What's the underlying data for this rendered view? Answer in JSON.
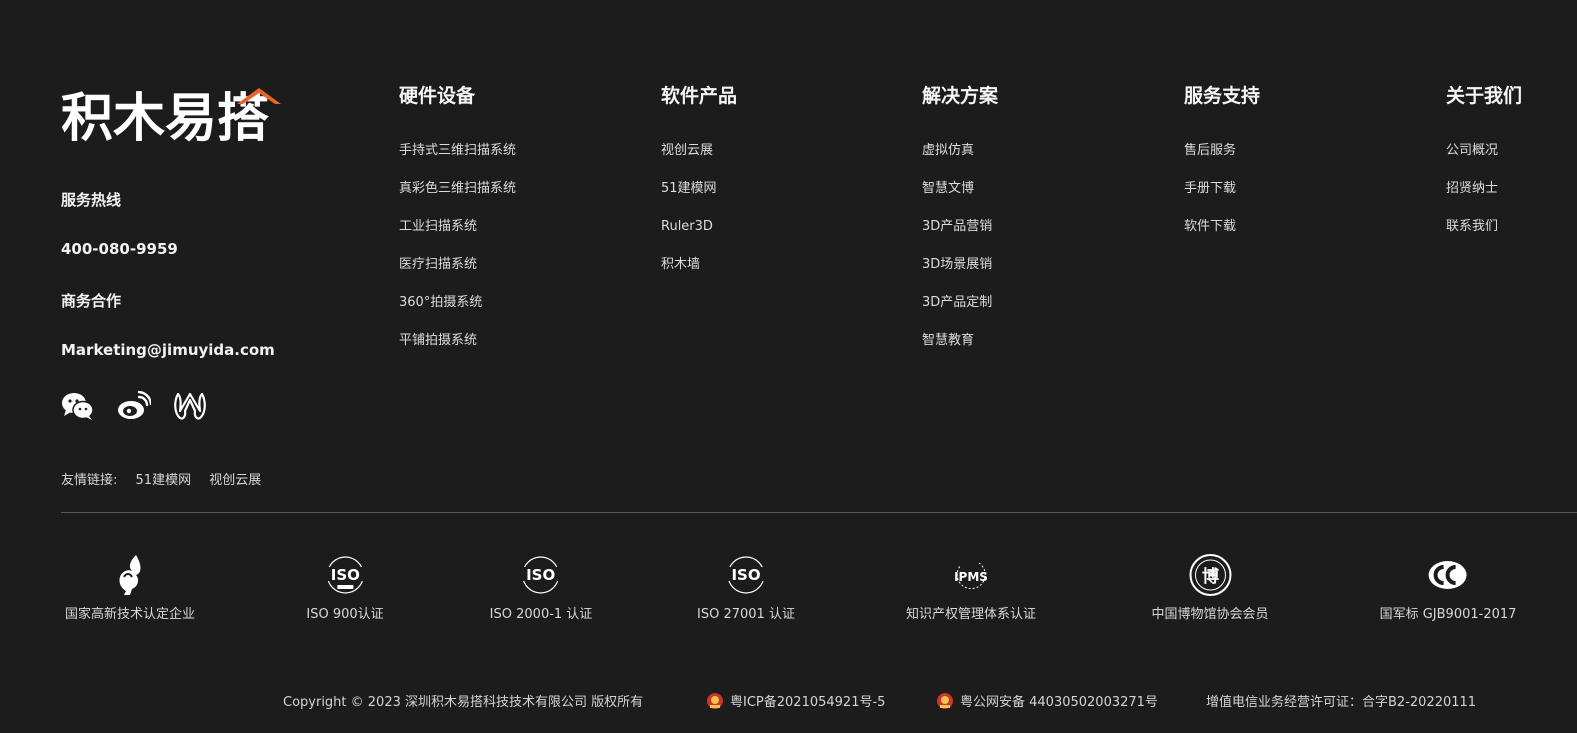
{
  "brand": {
    "logo_text": "积木易搭",
    "accent": "#e8622c"
  },
  "contact": {
    "hotline_label": "服务热线",
    "hotline_number": "400-080-9959",
    "business_label": "商务合作",
    "email": "Marketing@jimuyida.com"
  },
  "socials": [
    {
      "icon": "wechat-icon"
    },
    {
      "icon": "weibo-icon"
    },
    {
      "icon": "douyin-icon"
    }
  ],
  "friends": {
    "label": "友情链接:",
    "links": [
      "51建模网",
      "视创云展"
    ]
  },
  "columns": [
    {
      "title": "硬件设备",
      "items": [
        "手持式三维扫描系统",
        "真彩色三维扫描系统",
        "工业扫描系统",
        "医疗扫描系统",
        "360°拍摄系统",
        "平铺拍摄系统"
      ]
    },
    {
      "title": "软件产品",
      "items": [
        "视创云展",
        "51建模网",
        "Ruler3D",
        "积木墙"
      ]
    },
    {
      "title": "解决方案",
      "items": [
        "虚拟仿真",
        "智慧文博",
        "3D产品营销",
        "3D场景展销",
        "3D产品定制",
        "智慧教育"
      ]
    },
    {
      "title": "服务支持",
      "items": [
        "售后服务",
        "手册下载",
        "软件下载"
      ]
    },
    {
      "title": "关于我们",
      "items": [
        "公司概况",
        "招贤纳士",
        "联系我们"
      ]
    }
  ],
  "certs": [
    {
      "label": "国家高新技术认定企业",
      "icon": "hightech-icon"
    },
    {
      "label": "ISO 900认证",
      "icon": "iso-icon",
      "badge": "ISO"
    },
    {
      "label": "ISO 2000-1 认证",
      "icon": "iso-icon",
      "badge": "ISO"
    },
    {
      "label": "ISO 27001 认证",
      "icon": "iso-icon",
      "badge": "ISO"
    },
    {
      "label": "知识产权管理体系认证",
      "icon": "ipms-icon",
      "badge": "IPMS"
    },
    {
      "label": "中国博物馆协会会员",
      "icon": "museum-seal-icon",
      "badge": "博"
    },
    {
      "label": "国军标 GJB9001-2017",
      "icon": "gjb-icon"
    }
  ],
  "bottom": {
    "copyright": "Copyright © 2023 深圳积木易搭科技技术有限公司 版权所有",
    "icp": "粤ICP备2021054921号-5",
    "police": "粤公网安备 44030502003271号",
    "license": "增值电信业务经营许可证：合字B2-20220111"
  }
}
